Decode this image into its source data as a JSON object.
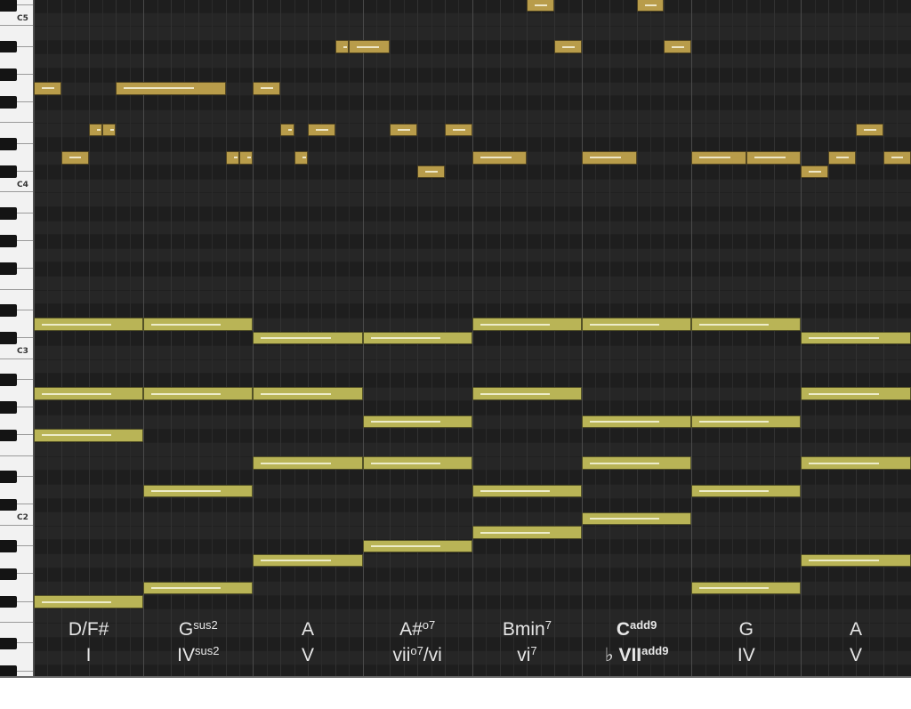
{
  "piano_roll": {
    "octave_labels": [
      {
        "name": "C5",
        "pitch": 72
      },
      {
        "name": "C4",
        "pitch": 60
      },
      {
        "name": "C3",
        "pitch": 48
      },
      {
        "name": "C2",
        "pitch": 36
      }
    ],
    "colors": {
      "background": "#262626",
      "black_key_row": "#1e1e1e",
      "melody_note": "#b89c4a",
      "chord_note": "#b9b456",
      "bar_line": "#4a4a4a",
      "beat_line": "#323232"
    },
    "notes": [
      {
        "pitch": 67,
        "start": 0,
        "length": 1,
        "part": "melody"
      },
      {
        "pitch": 62,
        "start": 1,
        "length": 1,
        "part": "melody"
      },
      {
        "pitch": 64,
        "start": 2,
        "length": 0.5,
        "part": "melody"
      },
      {
        "pitch": 64,
        "start": 2.5,
        "length": 0.5,
        "part": "melody"
      },
      {
        "pitch": 67,
        "start": 3,
        "length": 4,
        "part": "melody"
      },
      {
        "pitch": 62,
        "start": 7,
        "length": 0.5,
        "part": "melody"
      },
      {
        "pitch": 62,
        "start": 7.5,
        "length": 0.5,
        "part": "melody"
      },
      {
        "pitch": 67,
        "start": 8,
        "length": 1,
        "part": "melody"
      },
      {
        "pitch": 64,
        "start": 9,
        "length": 0.5,
        "part": "melody"
      },
      {
        "pitch": 62,
        "start": 9.5,
        "length": 0.5,
        "part": "melody"
      },
      {
        "pitch": 64,
        "start": 10,
        "length": 1,
        "part": "melody"
      },
      {
        "pitch": 70,
        "start": 11,
        "length": 0.5,
        "part": "melody"
      },
      {
        "pitch": 70,
        "start": 11.5,
        "length": 1.5,
        "part": "melody"
      },
      {
        "pitch": 64,
        "start": 13,
        "length": 1,
        "part": "melody"
      },
      {
        "pitch": 61,
        "start": 14,
        "length": 1,
        "part": "melody"
      },
      {
        "pitch": 64,
        "start": 15,
        "length": 1,
        "part": "melody"
      },
      {
        "pitch": 62,
        "start": 16,
        "length": 2,
        "part": "melody"
      },
      {
        "pitch": 73,
        "start": 18,
        "length": 1,
        "part": "melody"
      },
      {
        "pitch": 70,
        "start": 19,
        "length": 1,
        "part": "melody"
      },
      {
        "pitch": 62,
        "start": 20,
        "length": 2,
        "part": "melody"
      },
      {
        "pitch": 73,
        "start": 22,
        "length": 1,
        "part": "melody"
      },
      {
        "pitch": 70,
        "start": 23,
        "length": 1,
        "part": "melody"
      },
      {
        "pitch": 62,
        "start": 24,
        "length": 2,
        "part": "melody"
      },
      {
        "pitch": 62,
        "start": 26,
        "length": 2,
        "part": "melody"
      },
      {
        "pitch": 61,
        "start": 28,
        "length": 1,
        "part": "melody"
      },
      {
        "pitch": 62,
        "start": 29,
        "length": 1,
        "part": "melody"
      },
      {
        "pitch": 64,
        "start": 30,
        "length": 1,
        "part": "melody"
      },
      {
        "pitch": 62,
        "start": 31,
        "length": 1,
        "part": "melody"
      },
      {
        "pitch": 50,
        "start": 0,
        "length": 4,
        "part": "chord"
      },
      {
        "pitch": 45,
        "start": 0,
        "length": 4,
        "part": "chord"
      },
      {
        "pitch": 42,
        "start": 0,
        "length": 4,
        "part": "chord"
      },
      {
        "pitch": 30,
        "start": 0,
        "length": 4,
        "part": "chord"
      },
      {
        "pitch": 50,
        "start": 4,
        "length": 4,
        "part": "chord"
      },
      {
        "pitch": 45,
        "start": 4,
        "length": 4,
        "part": "chord"
      },
      {
        "pitch": 38,
        "start": 4,
        "length": 4,
        "part": "chord"
      },
      {
        "pitch": 31,
        "start": 4,
        "length": 4,
        "part": "chord"
      },
      {
        "pitch": 49,
        "start": 8,
        "length": 4,
        "part": "chord"
      },
      {
        "pitch": 45,
        "start": 8,
        "length": 4,
        "part": "chord"
      },
      {
        "pitch": 40,
        "start": 8,
        "length": 4,
        "part": "chord"
      },
      {
        "pitch": 33,
        "start": 8,
        "length": 4,
        "part": "chord"
      },
      {
        "pitch": 49,
        "start": 12,
        "length": 4,
        "part": "chord"
      },
      {
        "pitch": 43,
        "start": 12,
        "length": 4,
        "part": "chord"
      },
      {
        "pitch": 40,
        "start": 12,
        "length": 4,
        "part": "chord"
      },
      {
        "pitch": 34,
        "start": 12,
        "length": 4,
        "part": "chord"
      },
      {
        "pitch": 50,
        "start": 16,
        "length": 4,
        "part": "chord"
      },
      {
        "pitch": 45,
        "start": 16,
        "length": 4,
        "part": "chord"
      },
      {
        "pitch": 38,
        "start": 16,
        "length": 4,
        "part": "chord"
      },
      {
        "pitch": 35,
        "start": 16,
        "length": 4,
        "part": "chord"
      },
      {
        "pitch": 50,
        "start": 20,
        "length": 4,
        "part": "chord"
      },
      {
        "pitch": 43,
        "start": 20,
        "length": 4,
        "part": "chord"
      },
      {
        "pitch": 40,
        "start": 20,
        "length": 4,
        "part": "chord"
      },
      {
        "pitch": 36,
        "start": 20,
        "length": 4,
        "part": "chord"
      },
      {
        "pitch": 50,
        "start": 24,
        "length": 4,
        "part": "chord"
      },
      {
        "pitch": 43,
        "start": 24,
        "length": 4,
        "part": "chord"
      },
      {
        "pitch": 38,
        "start": 24,
        "length": 4,
        "part": "chord"
      },
      {
        "pitch": 31,
        "start": 24,
        "length": 4,
        "part": "chord"
      },
      {
        "pitch": 49,
        "start": 28,
        "length": 4,
        "part": "chord"
      },
      {
        "pitch": 45,
        "start": 28,
        "length": 4,
        "part": "chord"
      },
      {
        "pitch": 40,
        "start": 28,
        "length": 4,
        "part": "chord"
      },
      {
        "pitch": 33,
        "start": 28,
        "length": 4,
        "part": "chord"
      }
    ],
    "chords": [
      {
        "name": "D/F#",
        "name_sup": "",
        "roman": "I",
        "roman_sup": "",
        "flat": "",
        "bold": false
      },
      {
        "name": "G",
        "name_sup": "sus2",
        "roman": "IV",
        "roman_sup": "sus2",
        "flat": "",
        "bold": false
      },
      {
        "name": "A",
        "name_sup": "",
        "roman": "V",
        "roman_sup": "",
        "flat": "",
        "bold": false
      },
      {
        "name": "A#",
        "name_sup": "o7",
        "roman": "vii",
        "roman_sup": "o7",
        "roman_suffix": "/vi",
        "flat": "",
        "bold": false
      },
      {
        "name": "Bmin",
        "name_sup": "7",
        "roman": "vi",
        "roman_sup": "7",
        "flat": "",
        "bold": false
      },
      {
        "name": "C",
        "name_sup": "add9",
        "roman": "VII",
        "roman_sup": "add9",
        "flat": "♭",
        "bold": true
      },
      {
        "name": "G",
        "name_sup": "",
        "roman": "IV",
        "roman_sup": "",
        "flat": "",
        "bold": false
      },
      {
        "name": "A",
        "name_sup": "",
        "roman": "V",
        "roman_sup": "",
        "flat": "",
        "bold": false
      }
    ]
  }
}
